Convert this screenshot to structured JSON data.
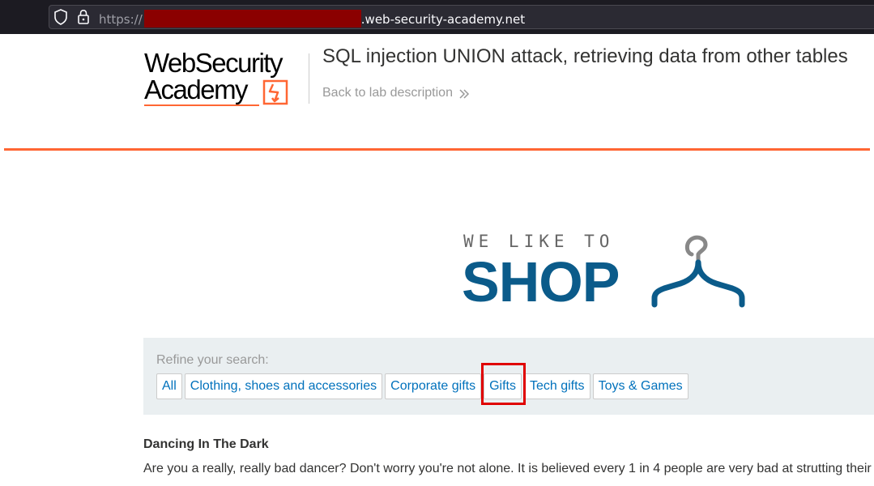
{
  "browser": {
    "url_scheme": "https://",
    "url_domain": ".web-security-academy.net"
  },
  "lab": {
    "logo_line1": "WebSecurity",
    "logo_line2": "Academy",
    "title": "SQL injection UNION attack, retrieving data from other tables",
    "back_link": "Back to lab description"
  },
  "banner": {
    "tagline": "WE LIKE TO",
    "shop_word": "SHOP"
  },
  "filters": {
    "refine_label": "Refine your search:",
    "categories": [
      "All",
      "Clothing, shoes and accessories",
      "Corporate gifts",
      "Gifts",
      "Tech gifts",
      "Toys & Games"
    ],
    "highlighted": "Gifts"
  },
  "product": {
    "title": "Dancing In The Dark",
    "description": "Are you a really, really bad dancer? Don't worry you're not alone. It is believed every 1 in 4 people are very bad at strutting their"
  },
  "colors": {
    "accent_orange": "#ff6633",
    "link_blue": "#0071bc",
    "shop_blue": "#0b5b8a",
    "highlight_red": "#e00000"
  }
}
